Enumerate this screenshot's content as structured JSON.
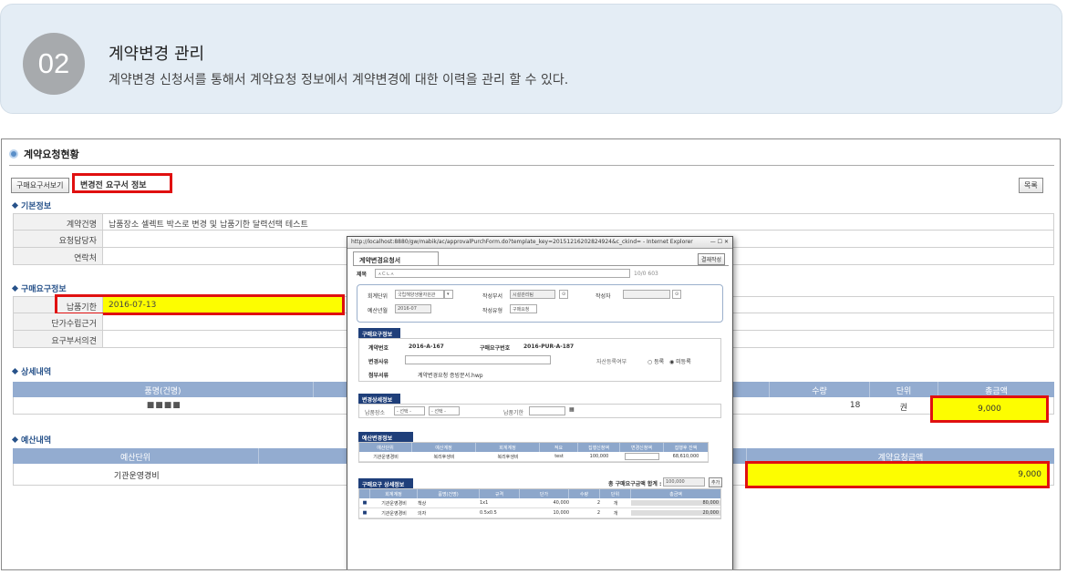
{
  "banner": {
    "number": "02",
    "title": "계약변경 관리",
    "description": "계약변경 신청서를 통해서 계약요청 정보에서 계약변경에 대한 이력을 관리 할 수 있다."
  },
  "screen": {
    "title": "계약요청현황",
    "tabs": {
      "view_request": "구매요구서보기",
      "before_change": "변경전 요구서 정보"
    },
    "list_button": "목록",
    "basic_info": {
      "section": "기본정보",
      "rows": [
        {
          "label": "계약건명",
          "value": "납품장소 셀렉트 박스로 변경 및 납품기한 달력선택 테스트"
        },
        {
          "label": "요청담당자",
          "value": ""
        },
        {
          "label": "연락처",
          "value": ""
        }
      ]
    },
    "purchase_info": {
      "section": "구매요구정보",
      "rows": [
        {
          "label": "납품기한",
          "value": "2016-07-13"
        },
        {
          "label": "단가수립근거",
          "value": ""
        },
        {
          "label": "요구부서의견",
          "value": ""
        }
      ]
    },
    "detail": {
      "section": "상세내역",
      "headers": [
        "품명(건명)",
        "수량",
        "단위",
        "총금액"
      ],
      "row": {
        "name": "■■■■",
        "qty": "18",
        "unit": "권",
        "total": "9,000"
      }
    },
    "budget": {
      "section": "예산내역",
      "headers": [
        "예산단위",
        "계약요청금액"
      ],
      "row": {
        "unit": "기관운영경비",
        "amount": "9,000"
      }
    }
  },
  "popup": {
    "url": "http://localhost:8880/gw/mabik/ac/approvalPurchForm.do?template_key=20151216202824924&c_ckind= - Internet Explorer",
    "tab": "계약변경요청서",
    "approve_button": "결재작성",
    "subject_label": "제목",
    "subject_value": "ㅅㄷㄴㅅ",
    "subject_count": "10/0 603",
    "fields": {
      "account_unit_label": "회계단위",
      "account_unit_value": "국립해양생물자원관",
      "writer_dept_label": "작성부서",
      "writer_dept_value": "시설관리팀",
      "writer_label": "작성자",
      "budget_year_label": "예산년월",
      "budget_year_value": "2016-07",
      "writer_type_label": "작성유형",
      "writer_type_value": "구매요청"
    },
    "purchase_section": "구매요구정보",
    "contract_no_label": "계약번호",
    "contract_no": "2016-A-167",
    "purchase_no_label": "구매요구번호",
    "purchase_no": "2016-PUR-A-187",
    "change_reason_label": "변경사유",
    "asset_label": "자산등록여부",
    "asset_opt1": "등록",
    "asset_opt2": "미등록",
    "attach_label": "첨부서류",
    "attach_file": "계약변경요청 증빙문서.hwp",
    "change_detail_section": "변경상세정보",
    "delivery_place_label": "납품장소",
    "select_opt": "- 선택 -",
    "delivery_date_label": "납품기한",
    "budget_section": "예산변경정보",
    "budget_headers": [
      "예산단위",
      "예산계정",
      "회계계정",
      "적요",
      "집행신청액",
      "변경신청액",
      "집행후 잔액"
    ],
    "budget_row": [
      "기관운영경비",
      "복리후생비",
      "복리후생비",
      "test",
      "100,000",
      "",
      "68,610,000"
    ],
    "detail_section": "구매요구 상세정보",
    "total_label": "총 구매요구금액 합계 :",
    "total_value": "100,000",
    "add_button": "추가",
    "detail_headers": [
      "회계계정",
      "품명(건명)",
      "규격",
      "단가",
      "수량",
      "단위",
      "총금액"
    ],
    "detail_rows": [
      [
        "기관운영경비",
        "책상",
        "1x1",
        "40,000",
        "2",
        "개",
        "80,000"
      ],
      [
        "기관운영경비",
        "의자",
        "0.5x0.5",
        "10,000",
        "2",
        "개",
        "20,000"
      ]
    ]
  }
}
